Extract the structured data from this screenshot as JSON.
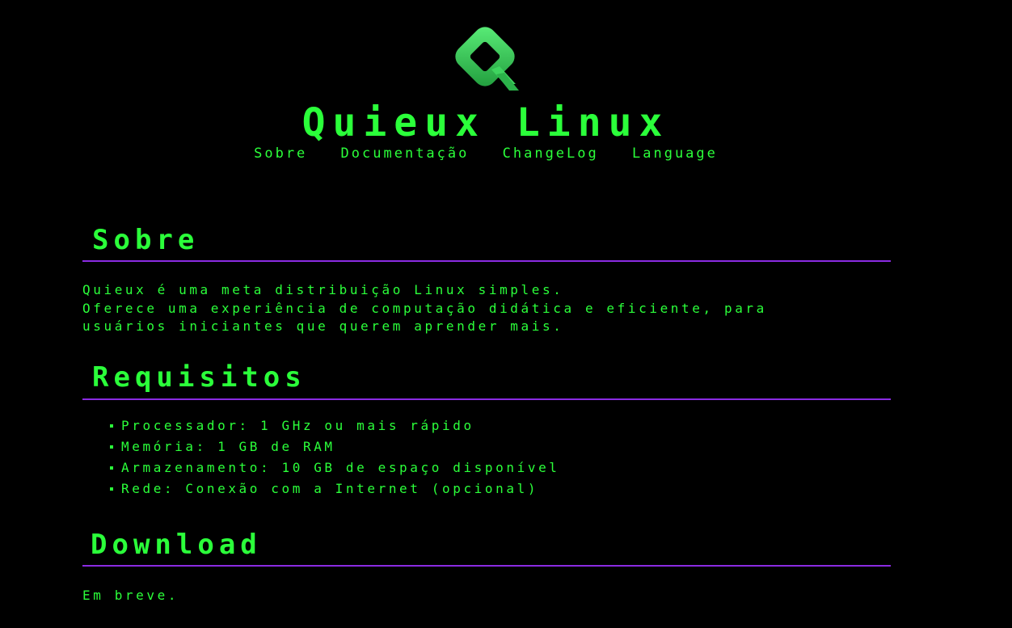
{
  "header": {
    "logo_icon": "quieux-q-logo-icon",
    "title": "Quieux Linux",
    "nav": [
      {
        "label": "Sobre"
      },
      {
        "label": "Documentação"
      },
      {
        "label": "ChangeLog"
      },
      {
        "label": "Language"
      }
    ]
  },
  "sections": {
    "about": {
      "title": "Sobre",
      "lines": [
        "Quieux é uma meta distribuição Linux simples.",
        "Oferece uma experiência de computação didática e eficiente, para",
        "usuários iniciantes que querem aprender mais."
      ]
    },
    "requirements": {
      "title": "Requisitos",
      "items": [
        "Processador: 1 GHz ou mais rápido",
        "Memória: 1 GB de RAM",
        "Armazenamento: 10 GB de espaço disponível",
        "Rede: Conexão com a Internet (opcional)"
      ]
    },
    "download": {
      "title": "Download",
      "text": "Em breve."
    }
  },
  "colors": {
    "background": "#000000",
    "text": "#2bff3a",
    "rule": "#8a2be2",
    "logo_light": "#5cf07a",
    "logo_dark": "#1f9a3b"
  }
}
